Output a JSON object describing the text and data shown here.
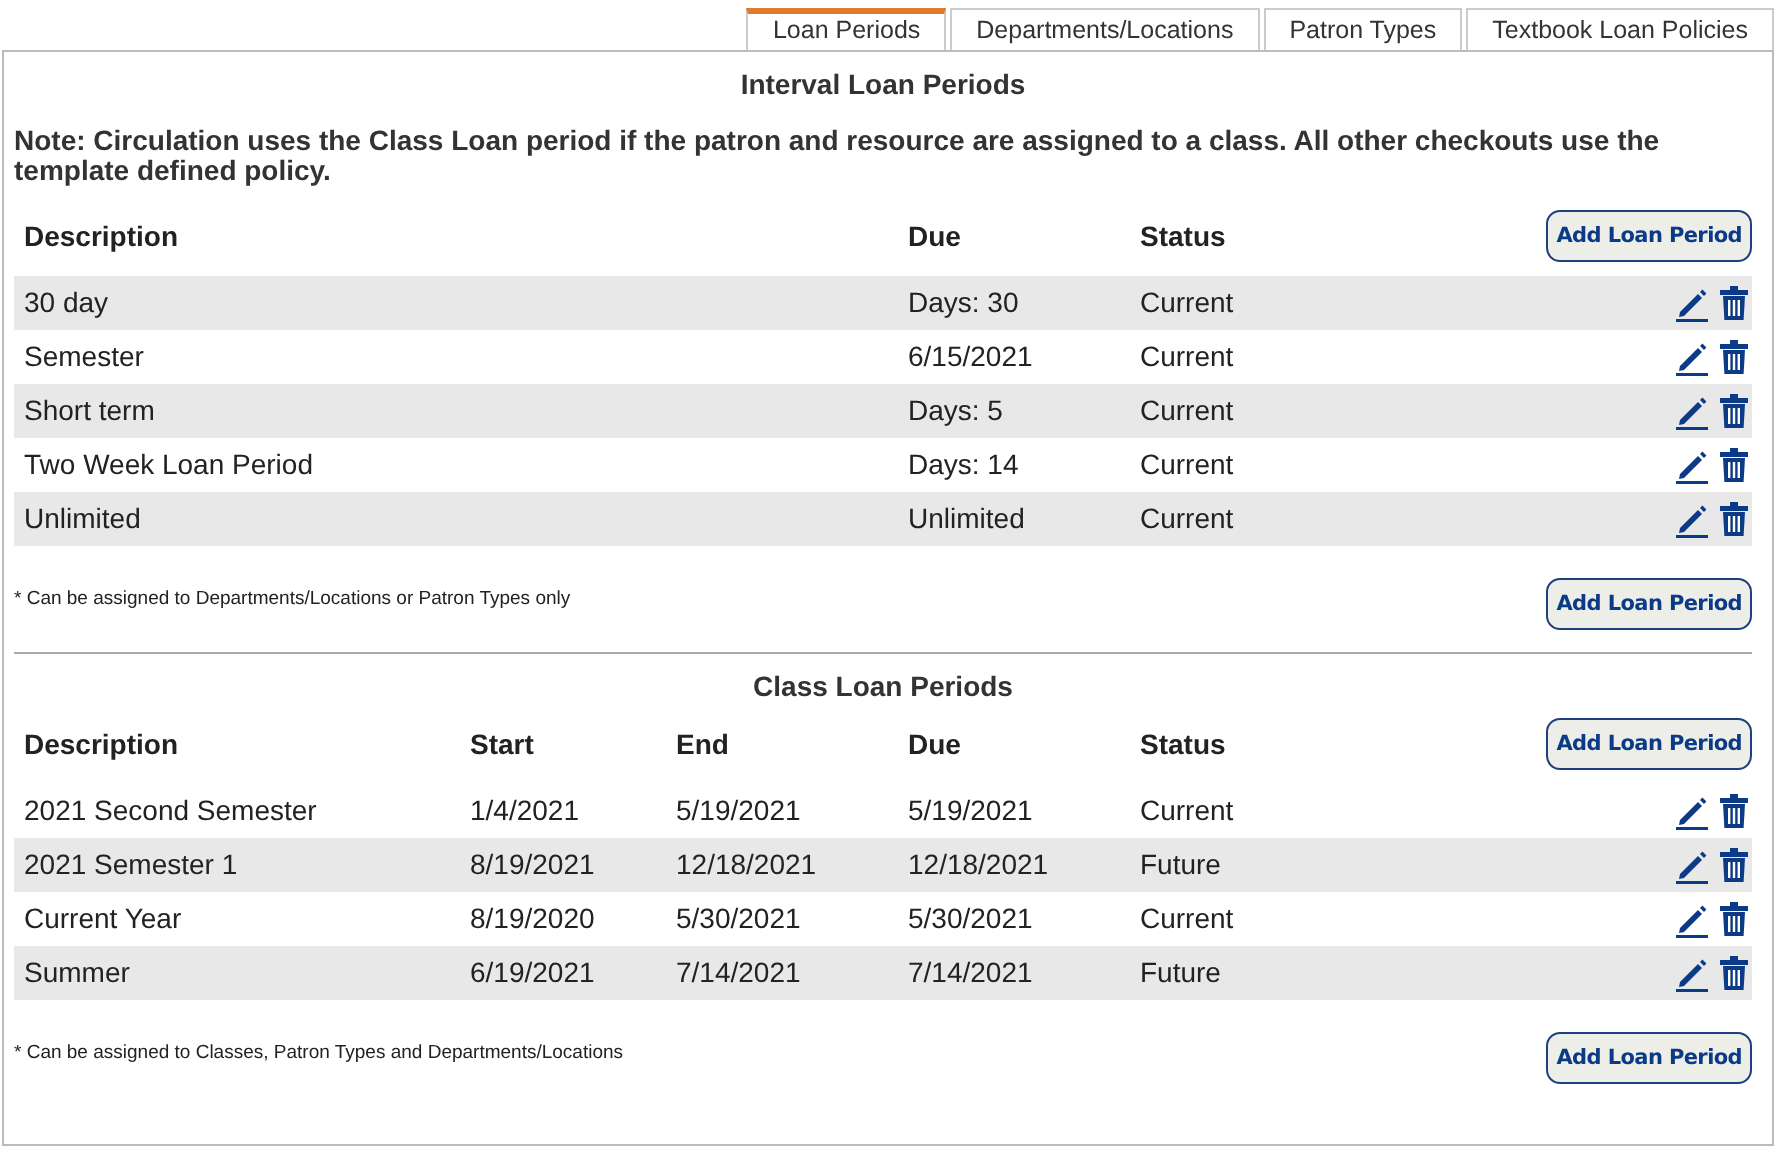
{
  "tabs": [
    {
      "label": "Loan Periods",
      "selected": true
    },
    {
      "label": "Departments/Locations",
      "selected": false
    },
    {
      "label": "Patron Types",
      "selected": false
    },
    {
      "label": "Textbook Loan Policies",
      "selected": false
    }
  ],
  "interval": {
    "title": "Interval Loan Periods",
    "note": "Note: Circulation uses the Class Loan period if the patron and resource are assigned to a class. All other checkouts use the template defined policy.",
    "columns": [
      "Description",
      "Due",
      "Status"
    ],
    "add_button": "Add Loan Period",
    "rows": [
      [
        "30 day",
        "Days: 30",
        "Current"
      ],
      [
        "Semester",
        "6/15/2021",
        "Current"
      ],
      [
        "Short term",
        "Days: 5",
        "Current"
      ],
      [
        "Two Week Loan Period",
        "Days: 14",
        "Current"
      ],
      [
        "Unlimited",
        "Unlimited",
        "Current"
      ]
    ],
    "footnote": "* Can be assigned to Departments/Locations or Patron Types only",
    "footer_button": "Add Loan Period"
  },
  "class": {
    "title": "Class Loan Periods",
    "columns": [
      "Description",
      "Start",
      "End",
      "Due",
      "Status"
    ],
    "add_button": "Add Loan Period",
    "rows": [
      [
        "2021 Second Semester",
        "1/4/2021",
        "5/19/2021",
        "5/19/2021",
        "Current"
      ],
      [
        "2021 Semester 1",
        "8/19/2021",
        "12/18/2021",
        "12/18/2021",
        "Future"
      ],
      [
        "Current Year",
        "8/19/2020",
        "5/30/2021",
        "5/30/2021",
        "Current"
      ],
      [
        "Summer",
        "6/19/2021",
        "7/14/2021",
        "7/14/2021",
        "Future"
      ]
    ],
    "footnote": "* Can be assigned to Classes, Patron Types and Departments/Locations",
    "footer_button": "Add Loan Period"
  }
}
